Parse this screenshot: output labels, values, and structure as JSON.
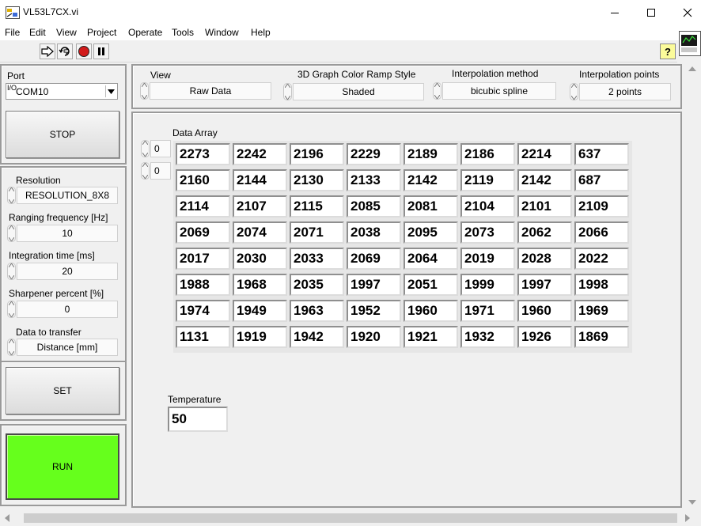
{
  "window": {
    "title": "VL53L7CX.vi"
  },
  "menu": [
    "File",
    "Edit",
    "View",
    "Project",
    "Operate",
    "Tools",
    "Window",
    "Help"
  ],
  "toolbar": {
    "buttons": [
      "run-arrow-icon",
      "run-continuously-icon",
      "abort-icon",
      "pause-icon"
    ],
    "help": "?"
  },
  "left": {
    "port_label": "Port",
    "port_prefix": "I/O",
    "port_value": "COM10",
    "stop_label": "STOP",
    "resolution_label": "Resolution",
    "resolution_value": "RESOLUTION_8X8",
    "frequency_label": "Ranging frequency [Hz]",
    "frequency_value": "10",
    "integration_label": "Integration time [ms]",
    "integration_value": "20",
    "sharpener_label": "Sharpener percent [%]",
    "sharpener_value": "0",
    "transfer_label": "Data to transfer",
    "transfer_value": "Distance [mm]",
    "set_label": "SET",
    "run_label": "RUN"
  },
  "top": {
    "view_label": "View",
    "view_value": "Raw Data",
    "ramp_label": "3D Graph Color Ramp Style",
    "ramp_value": "Shaded",
    "interp_label": "Interpolation method",
    "interp_value": "bicubic spline",
    "points_label": "Interpolation points",
    "points_value": "2 points"
  },
  "main": {
    "array_label": "Data Array",
    "index_row": "0",
    "index_col": "0",
    "array": [
      [
        "2273",
        "2242",
        "2196",
        "2229",
        "2189",
        "2186",
        "2214",
        "637"
      ],
      [
        "2160",
        "2144",
        "2130",
        "2133",
        "2142",
        "2119",
        "2142",
        "687"
      ],
      [
        "2114",
        "2107",
        "2115",
        "2085",
        "2081",
        "2104",
        "2101",
        "2109"
      ],
      [
        "2069",
        "2074",
        "2071",
        "2038",
        "2095",
        "2073",
        "2062",
        "2066"
      ],
      [
        "2017",
        "2030",
        "2033",
        "2069",
        "2064",
        "2019",
        "2028",
        "2022"
      ],
      [
        "1988",
        "1968",
        "2035",
        "1997",
        "2051",
        "1999",
        "1997",
        "1998"
      ],
      [
        "1974",
        "1949",
        "1963",
        "1952",
        "1960",
        "1971",
        "1960",
        "1969"
      ],
      [
        "1131",
        "1919",
        "1942",
        "1920",
        "1921",
        "1932",
        "1926",
        "1869"
      ]
    ],
    "temperature_label": "Temperature",
    "temperature_value": "50"
  },
  "colors": {
    "run": "#66ff1c",
    "panel_border": "#9a9a9a",
    "background": "#f0f0f0"
  }
}
